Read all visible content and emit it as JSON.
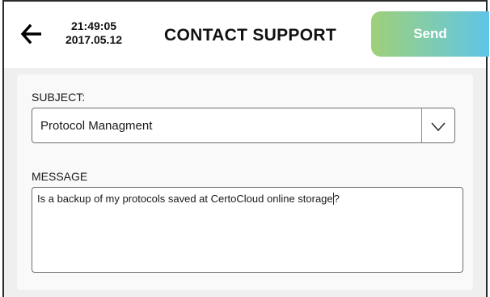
{
  "header": {
    "time": "21:49:05",
    "date": "2017.05.12",
    "title": "CONTACT SUPPORT",
    "send_label": "Send",
    "back_icon": "arrow-left-icon"
  },
  "form": {
    "subject_label": "SUBJECT:",
    "subject_value": "Protocol Managment",
    "subject_icon": "chevron-down-icon",
    "message_label": "MESSAGE",
    "message_text_before_caret": "Is a backup of my protocols saved at CertoCloud online storage",
    "message_text_after_caret": "?"
  },
  "colors": {
    "send_gradient_start": "#9fd079",
    "send_gradient_end": "#5fc4e6",
    "panel_bg": "#f9f9f9",
    "content_bg": "#efefef"
  }
}
